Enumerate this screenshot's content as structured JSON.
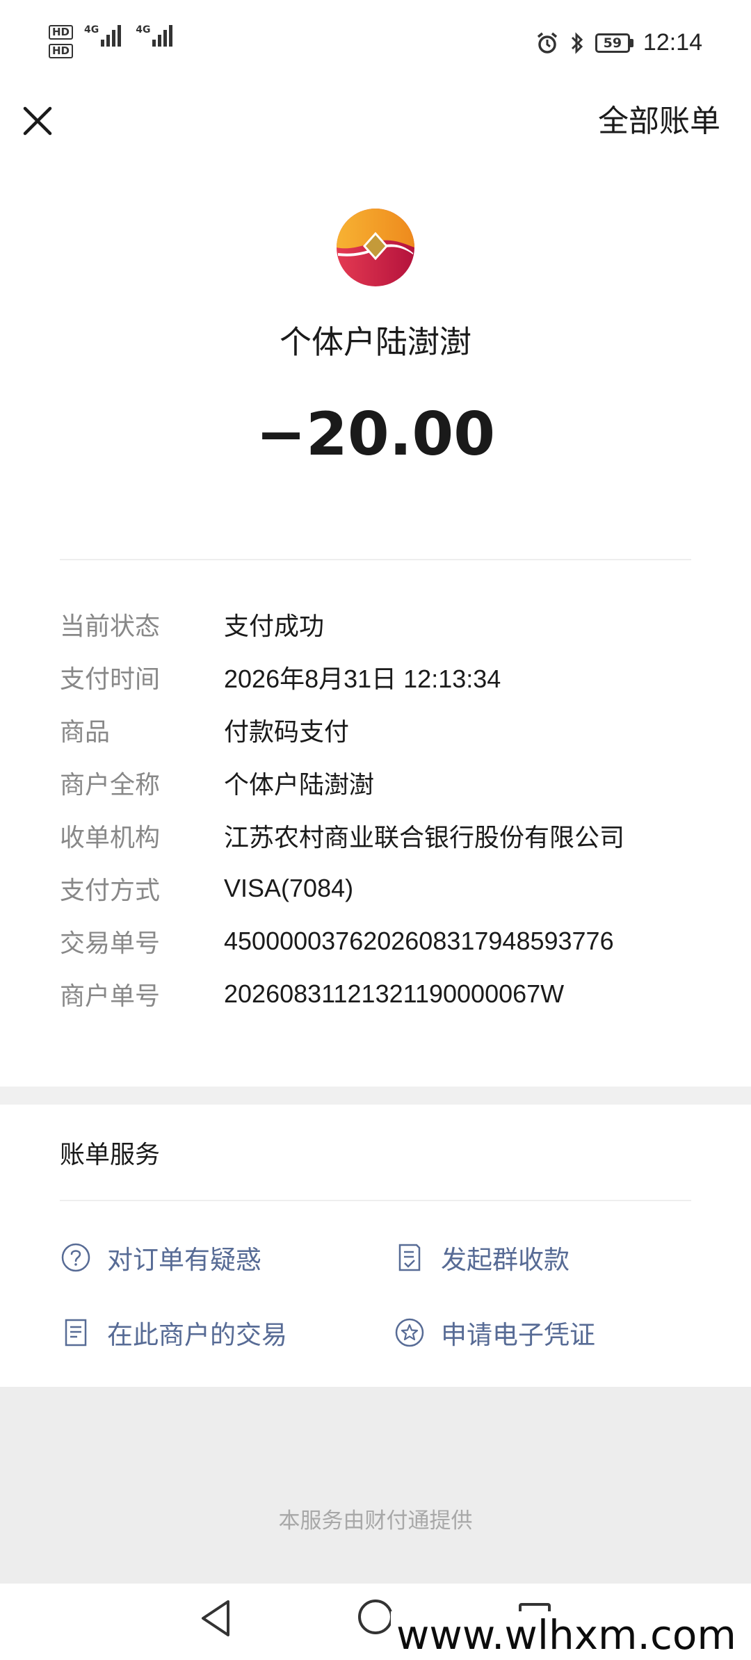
{
  "status_bar": {
    "hd1": "HD",
    "hd2": "HD",
    "net1": "4G",
    "net2": "4G",
    "battery": "59",
    "time": "12:14"
  },
  "top_bar": {
    "close_icon": "close-icon",
    "all_bills_label": "全部账单"
  },
  "header": {
    "merchant_name": "个体户陆澍澍",
    "amount": "−20.00"
  },
  "details": [
    {
      "label": "当前状态",
      "value": "支付成功"
    },
    {
      "label": "支付时间",
      "value": "2026年8月31日 12:13:34"
    },
    {
      "label": "商品",
      "value": "付款码支付"
    },
    {
      "label": "商户全称",
      "value": "个体户陆澍澍"
    },
    {
      "label": "收单机构",
      "value": "江苏农村商业联合银行股份有限公司"
    },
    {
      "label": "支付方式",
      "value": "VISA(7084)"
    },
    {
      "label": "交易单号",
      "value": "4500000376202608317948593776"
    },
    {
      "label": "商户单号",
      "value": "20260831121321190000067W"
    }
  ],
  "services": {
    "title": "账单服务",
    "items": [
      {
        "label": "对订单有疑惑",
        "icon": "question-icon"
      },
      {
        "label": "发起群收款",
        "icon": "checklist-icon"
      },
      {
        "label": "在此商户的交易",
        "icon": "document-icon"
      },
      {
        "label": "申请电子凭证",
        "icon": "star-badge-icon"
      }
    ]
  },
  "footer": {
    "text": "本服务由财付通提供"
  },
  "watermark": "www.wlhxm.com",
  "colors": {
    "link": "#576b95",
    "label": "#888888",
    "footer_bg": "#ededed"
  }
}
